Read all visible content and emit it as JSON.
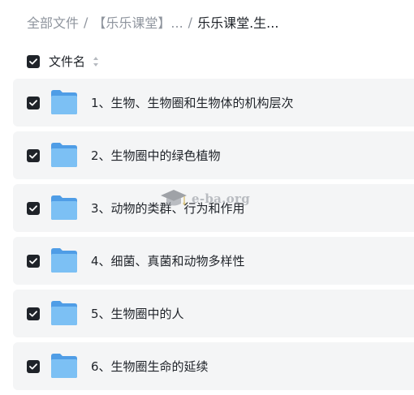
{
  "breadcrumb": {
    "root": "全部文件",
    "middle": "【乐乐课堂】...",
    "current": "乐乐课堂.生...",
    "separator": "/"
  },
  "list_header": {
    "name_label": "文件名",
    "select_all_checked": true
  },
  "files": [
    {
      "name": "1、生物、生物圈和生物体的机构层次",
      "checked": true,
      "icon": "folder-icon"
    },
    {
      "name": "2、生物圈中的绿色植物",
      "checked": true,
      "icon": "folder-icon"
    },
    {
      "name": "3、动物的类群、行为和作用",
      "checked": true,
      "icon": "folder-icon"
    },
    {
      "name": "4、细菌、真菌和动物多样性",
      "checked": true,
      "icon": "folder-icon"
    },
    {
      "name": "5、生物圈中的人",
      "checked": true,
      "icon": "folder-icon"
    },
    {
      "name": "6、生物圈生命的延续",
      "checked": true,
      "icon": "folder-icon"
    }
  ],
  "watermark": {
    "text": "e-ba.org",
    "icon": "graduation-cap-icon"
  },
  "colors": {
    "row_background": "#f4f5f6",
    "checkbox_fill": "#1f2329",
    "folder_blue": "#6cb4f0",
    "muted_text": "#8f959e"
  }
}
